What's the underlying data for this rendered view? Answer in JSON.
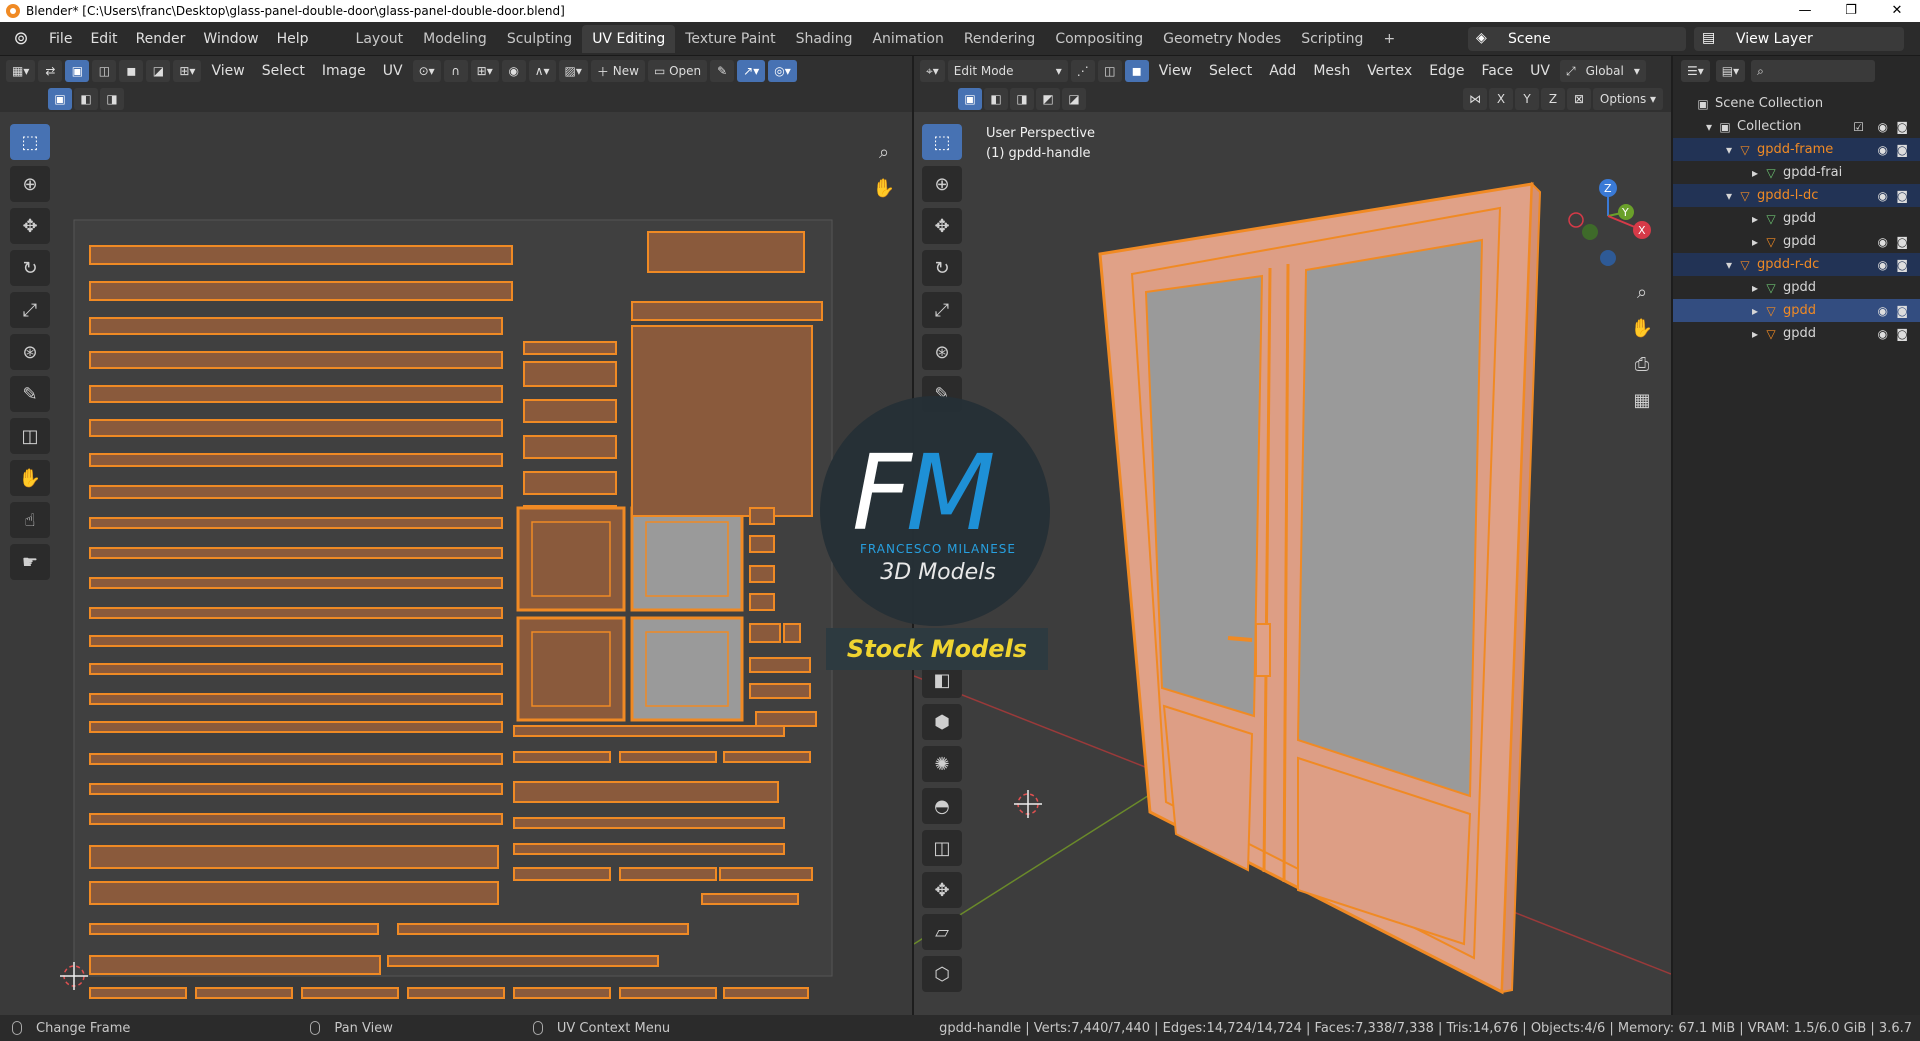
{
  "window": {
    "title": "Blender* [C:\\Users\\franc\\Desktop\\glass-panel-double-door\\glass-panel-double-door.blend]",
    "controls": [
      "—",
      "❐",
      "✕"
    ]
  },
  "menu": [
    "File",
    "Edit",
    "Render",
    "Window",
    "Help"
  ],
  "workspaces": {
    "active": "UV Editing",
    "tabs": [
      "Layout",
      "Modeling",
      "Sculpting",
      "UV Editing",
      "Texture Paint",
      "Shading",
      "Animation",
      "Rendering",
      "Compositing",
      "Geometry Nodes",
      "Scripting",
      "+"
    ]
  },
  "scene": {
    "name": "Scene",
    "view_layer": "View Layer"
  },
  "uv_editor": {
    "menus": [
      "View",
      "Select",
      "Image",
      "UV"
    ],
    "new_label": "New",
    "open_label": "Open"
  },
  "viewport": {
    "mode": "Edit Mode",
    "menus": [
      "View",
      "Select",
      "Add",
      "Mesh",
      "Vertex",
      "Edge",
      "Face",
      "UV"
    ],
    "orientation": "Global",
    "options_label": "Options",
    "axis_labels": [
      "X",
      "Y",
      "Z"
    ],
    "overlay_title": "User Perspective",
    "overlay_object": "(1) gpdd-handle",
    "gizmo": {
      "x": "X",
      "y": "Y",
      "z": "Z"
    }
  },
  "watermark": {
    "logo": "FM",
    "name": "FRANCESCO MILANESE",
    "tagline": "3D Models",
    "banner": "Stock Models"
  },
  "outliner": {
    "rows": [
      {
        "name": "Scene Collection",
        "indent": 0,
        "icon": "▣",
        "color": "#d6d6d6"
      },
      {
        "name": "Collection",
        "indent": 1,
        "icon": "▣",
        "color": "#d6d6d6"
      },
      {
        "name": "gpdd-frame",
        "indent": 2,
        "icon": "▽",
        "color": "#f08a24"
      },
      {
        "name": "gpdd-frai",
        "indent": 3,
        "icon": "▽",
        "color": "#d6d6d6"
      },
      {
        "name": "gpdd-l-dc",
        "indent": 2,
        "icon": "▽",
        "color": "#f08a24"
      },
      {
        "name": "gpdd",
        "indent": 3,
        "icon": "▽",
        "color": "#d6d6d6"
      },
      {
        "name": "gpdd",
        "indent": 3,
        "icon": "▽",
        "color": "#d6d6d6"
      },
      {
        "name": "gpdd-r-dc",
        "indent": 2,
        "icon": "▽",
        "color": "#f08a24"
      },
      {
        "name": "gpdd",
        "indent": 3,
        "icon": "▽",
        "color": "#d6d6d6"
      },
      {
        "name": "gpdd",
        "indent": 3,
        "icon": "▽",
        "color": "#f08a24"
      },
      {
        "name": "gpdd",
        "indent": 3,
        "icon": "▽",
        "color": "#d6d6d6"
      }
    ]
  },
  "status": {
    "left": [
      "Change Frame",
      "Pan View",
      "UV Context Menu"
    ],
    "stats": "gpdd-handle | Verts:7,440/7,440 | Edges:14,724/14,724 | Faces:7,338/7,338 | Tris:14,676 | Objects:4/6 | Memory: 67.1 MiB | VRAM: 1.5/6.0 GiB | 3.6.7"
  },
  "colors": {
    "accent": "#4772b3",
    "uv_orange": "#f08a24",
    "uv_fill": "#8a5a3c",
    "door_fill": "#e0a187",
    "glass": "#9a9a9a",
    "selected_text": "#f08a24"
  }
}
